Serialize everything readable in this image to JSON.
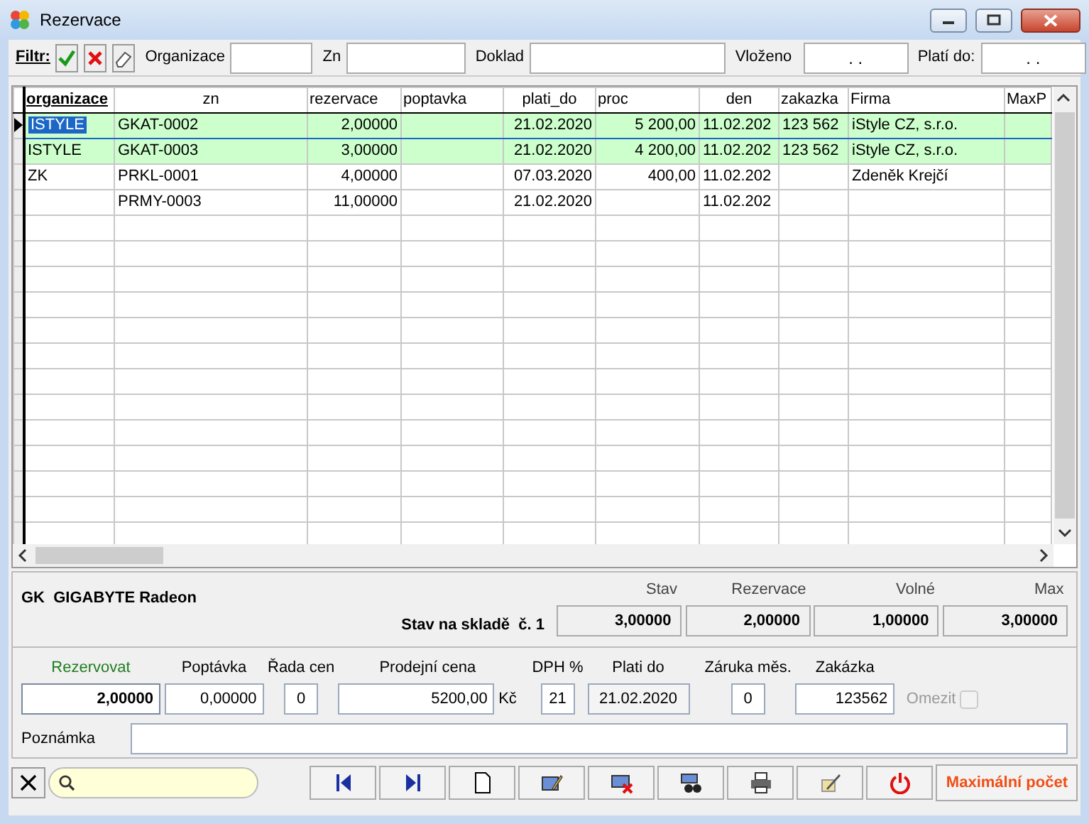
{
  "window": {
    "title": "Rezervace"
  },
  "filter": {
    "label": "Filtr:",
    "fields": [
      {
        "label": "Organizace"
      },
      {
        "label": "Zn"
      },
      {
        "label": "Doklad"
      },
      {
        "label": "Vloženo",
        "value": ". ."
      },
      {
        "label": "Platí do:",
        "value": ". ."
      }
    ]
  },
  "grid": {
    "columns": [
      {
        "label": "organizace",
        "bold": true
      },
      {
        "label": "zn",
        "bold": false
      },
      {
        "label": "rezervace",
        "bold": false
      },
      {
        "label": "poptavka",
        "bold": false
      },
      {
        "label": "plati_do",
        "bold": false
      },
      {
        "label": "proc",
        "bold": false
      },
      {
        "label": "den",
        "bold": false
      },
      {
        "label": "zakazka",
        "bold": false
      },
      {
        "label": "Firma",
        "bold": false
      },
      {
        "label": "MaxP",
        "bold": false
      }
    ],
    "rows": [
      {
        "selected": true,
        "highlighted": true,
        "cells": [
          "ISTYLE",
          "GKAT-0002",
          "2,00000",
          null,
          "21.02.2020",
          "5 200,00",
          "11.02.202",
          "123 562",
          "iStyle CZ, s.r.o.",
          null
        ]
      },
      {
        "selected": false,
        "highlighted": true,
        "cells": [
          "ISTYLE",
          "GKAT-0003",
          "3,00000",
          null,
          "21.02.2020",
          "4 200,00",
          "11.02.202",
          "123 562",
          "iStyle CZ, s.r.o.",
          null
        ]
      },
      {
        "selected": false,
        "highlighted": false,
        "cells": [
          "ZK",
          "PRKL-0001",
          "4,00000",
          null,
          "07.03.2020",
          "400,00",
          "11.02.202",
          null,
          "Zdeněk Krejčí",
          null
        ]
      },
      {
        "selected": false,
        "highlighted": false,
        "cells": [
          null,
          "PRMY-0003",
          "11,00000",
          null,
          "21.02.2020",
          null,
          "11.02.202",
          null,
          null,
          null
        ]
      }
    ]
  },
  "summary": {
    "title": "GK  GIGABYTE Radeon",
    "store_label": "Stav na skladě  č. 1",
    "stats": [
      {
        "label": "Stav",
        "value": "3,00000"
      },
      {
        "label": "Rezervace",
        "value": "2,00000"
      },
      {
        "label": "Volné",
        "value": "1,00000"
      },
      {
        "label": "Max",
        "value": "3,00000"
      }
    ]
  },
  "form": {
    "fields": [
      {
        "label": "Rezervovat",
        "value": "2,00000",
        "kind": "primary"
      },
      {
        "label": "Poptávka",
        "value": "0,00000",
        "kind": "number"
      },
      {
        "label": "Řada cen",
        "value": "0",
        "kind": "small"
      },
      {
        "label": "Prodejní cena",
        "value": "5200,00",
        "kind": "number",
        "unit": "Kč"
      },
      {
        "label": "DPH %",
        "value": "21",
        "kind": "small"
      },
      {
        "label": "Plati do",
        "value": "21.02.2020",
        "kind": "date"
      },
      {
        "label": "Záruka měs.",
        "value": "0",
        "kind": "small"
      },
      {
        "label": "Zakázka",
        "value": "123562",
        "kind": "number"
      }
    ],
    "limit": {
      "label": "Omezit",
      "checked": false,
      "disabled": true
    },
    "note": {
      "label": "Poznámka"
    }
  },
  "toolbar": {
    "buttons": [
      {
        "kind": "first"
      },
      {
        "kind": "last"
      },
      {
        "kind": "new"
      },
      {
        "kind": "edit"
      },
      {
        "kind": "delete"
      },
      {
        "kind": "find"
      },
      {
        "kind": "print"
      },
      {
        "kind": "tools"
      },
      {
        "kind": "power"
      }
    ],
    "action": "Maximální počet"
  }
}
